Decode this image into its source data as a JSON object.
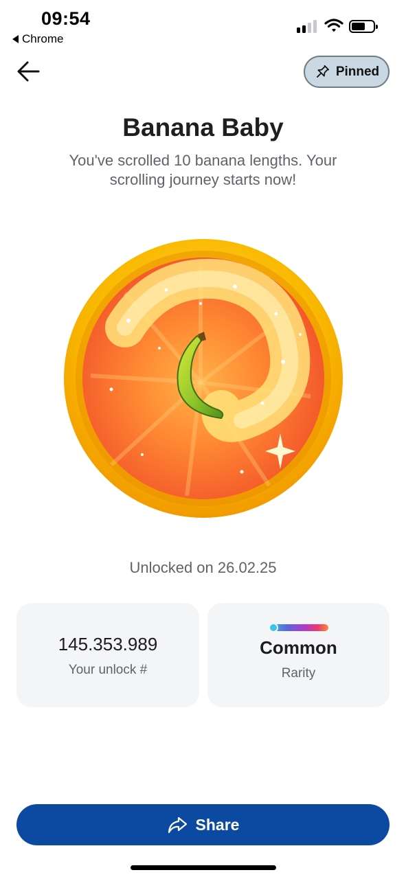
{
  "status_bar": {
    "time": "09:54",
    "back_app": "Chrome",
    "icons": [
      "signal-icon",
      "wifi-icon",
      "battery-icon"
    ]
  },
  "nav": {
    "pinned_label": "Pinned",
    "icons": [
      "back-arrow-icon",
      "pin-icon"
    ]
  },
  "achievement": {
    "title": "Banana Baby",
    "description": "You've scrolled 10 banana lengths. Your scrolling journey starts now!",
    "unlocked_text": "Unlocked on 26.02.25",
    "badge_icon": "banana-badge"
  },
  "stats": {
    "unlock_number": "145.353.989",
    "unlock_label": "Your unlock #",
    "rarity_value": "Common",
    "rarity_label": "Rarity"
  },
  "share": {
    "label": "Share",
    "icon": "share-arrow-icon"
  },
  "colors": {
    "share_button": "#0b4aa0",
    "pinned_bg": "#c9d8e2",
    "card_bg": "#f4f5f7",
    "badge_ring": "#f7b800",
    "badge_inner": "#f56a2e"
  }
}
